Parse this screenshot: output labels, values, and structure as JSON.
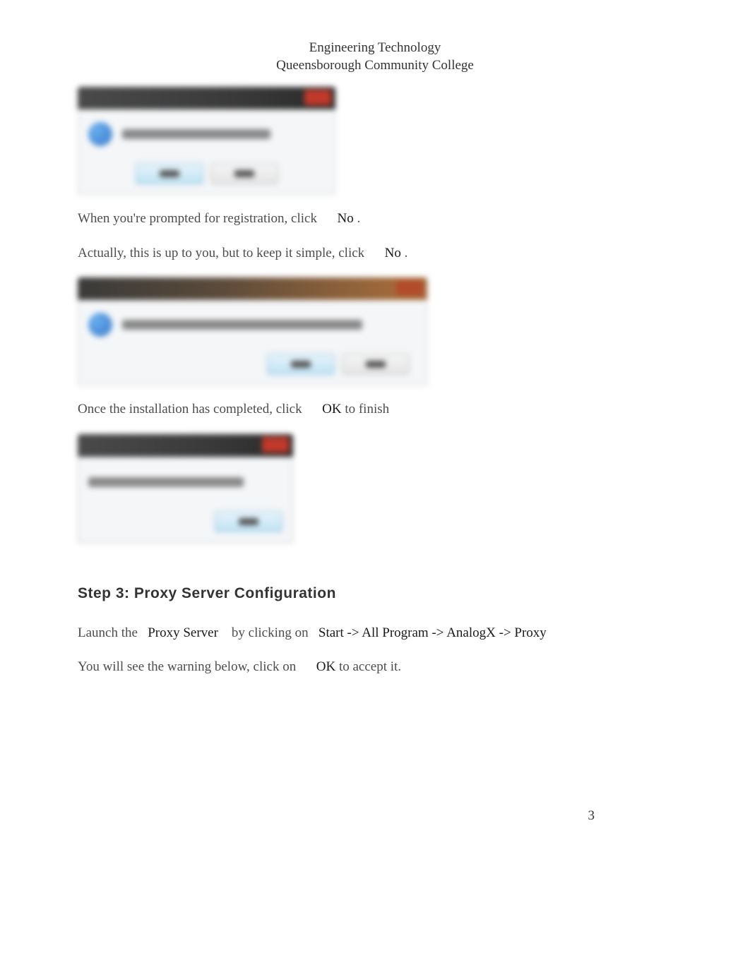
{
  "header": {
    "line1": "Engineering Technology",
    "line2": "Queensborough Community College"
  },
  "para1": {
    "prefix": "When you're prompted for registration, click ",
    "bold": "No",
    "suffix": " ."
  },
  "para2": {
    "prefix": "Actually, this is up to you, but to keep it simple, click ",
    "bold": "No",
    "suffix": " ."
  },
  "para3": {
    "prefix": "Once the installation has completed, click ",
    "bold": "OK",
    "suffix": " to finish"
  },
  "step_title": "Step 3: Proxy Server Configuration",
  "para4": {
    "prefix": "Launch the ",
    "bold1": "Proxy Server",
    "mid": " by clicking on ",
    "bold2": "Start -> All Program -> AnalogX -> Proxy"
  },
  "para5": {
    "prefix": "You will see the warning below, click on ",
    "bold": "OK",
    "suffix": " to accept it."
  },
  "page_number": "3"
}
